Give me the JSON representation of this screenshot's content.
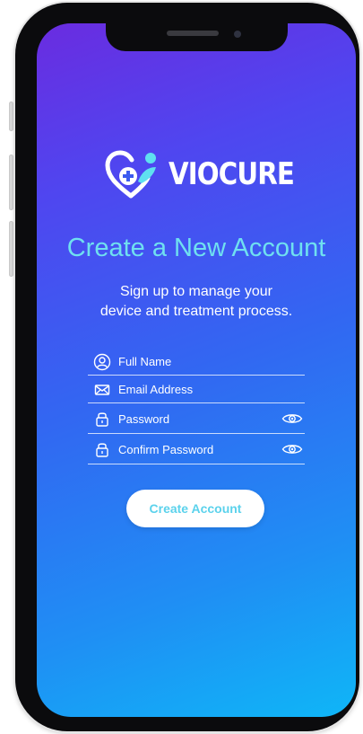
{
  "brand": {
    "name": "VIOCURE",
    "logo_icon": "heart-plus-person-icon"
  },
  "header": {
    "title": "Create a New Account",
    "subtitle_line1": "Sign up to manage your",
    "subtitle_line2": "device and treatment process."
  },
  "form": {
    "full_name": {
      "placeholder": "Full Name",
      "value": "",
      "icon": "person-icon"
    },
    "email": {
      "placeholder": "Email Address",
      "value": "",
      "icon": "envelope-icon"
    },
    "password": {
      "placeholder": "Password",
      "value": "",
      "icon": "lock-icon",
      "toggle_icon": "eye-icon"
    },
    "confirm_password": {
      "placeholder": "Confirm Password",
      "value": "",
      "icon": "lock-icon",
      "toggle_icon": "eye-icon"
    }
  },
  "actions": {
    "create_account_label": "Create Account"
  },
  "colors": {
    "gradient_start": "#6a2ce0",
    "gradient_end": "#0fb6f7",
    "title_color": "#6fe0f0",
    "button_text": "#5bd2ec",
    "frame": "#0b0b0d"
  }
}
